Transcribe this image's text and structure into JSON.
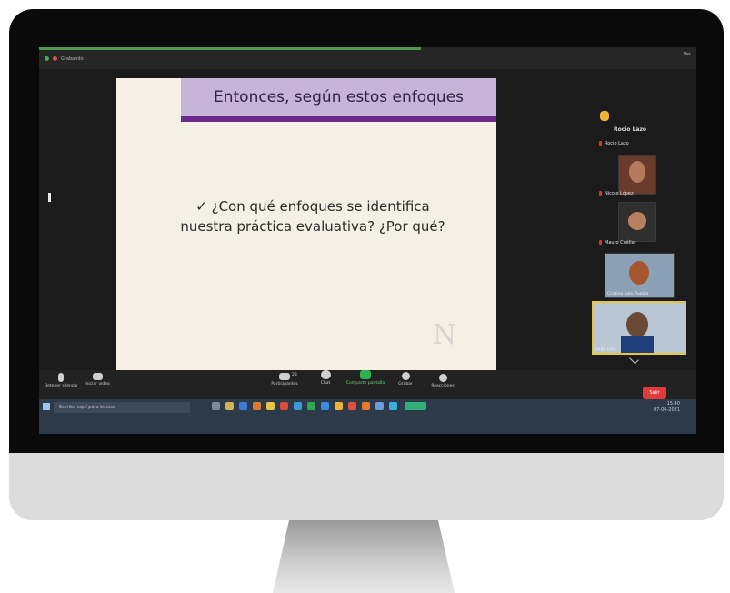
{
  "meeting": {
    "window_label": "Grabando",
    "view_label": "Ver"
  },
  "slide": {
    "title": "Entonces, según estos enfoques",
    "question_line1": "✓ ¿Con qué enfoques se identifica",
    "question_line2": "nuestra práctica evaluativa? ¿Por qué?"
  },
  "participants": {
    "header_name": "Rocio Lazo",
    "names": [
      "Rocio Lazo",
      "Nicole López",
      "Mauro Cuéllar",
      "Cristina Soto Puebla",
      "Jorge Díaz"
    ]
  },
  "toolbar": {
    "items": [
      "Detener silencio",
      "Iniciar video",
      "Participantes",
      "Chat",
      "Compartir pantalla",
      "Grabar",
      "Reacciones"
    ],
    "participant_count": "28",
    "leave_label": "Salir"
  },
  "taskbar": {
    "search_placeholder": "Escribe aquí para buscar",
    "time": "15:40",
    "date": "07-06-2021"
  },
  "colors": {
    "banner": "#c6b4d9",
    "banner_border": "#6b2a8c",
    "leave_button": "#e03b3b",
    "share_button": "#2bb24c"
  }
}
